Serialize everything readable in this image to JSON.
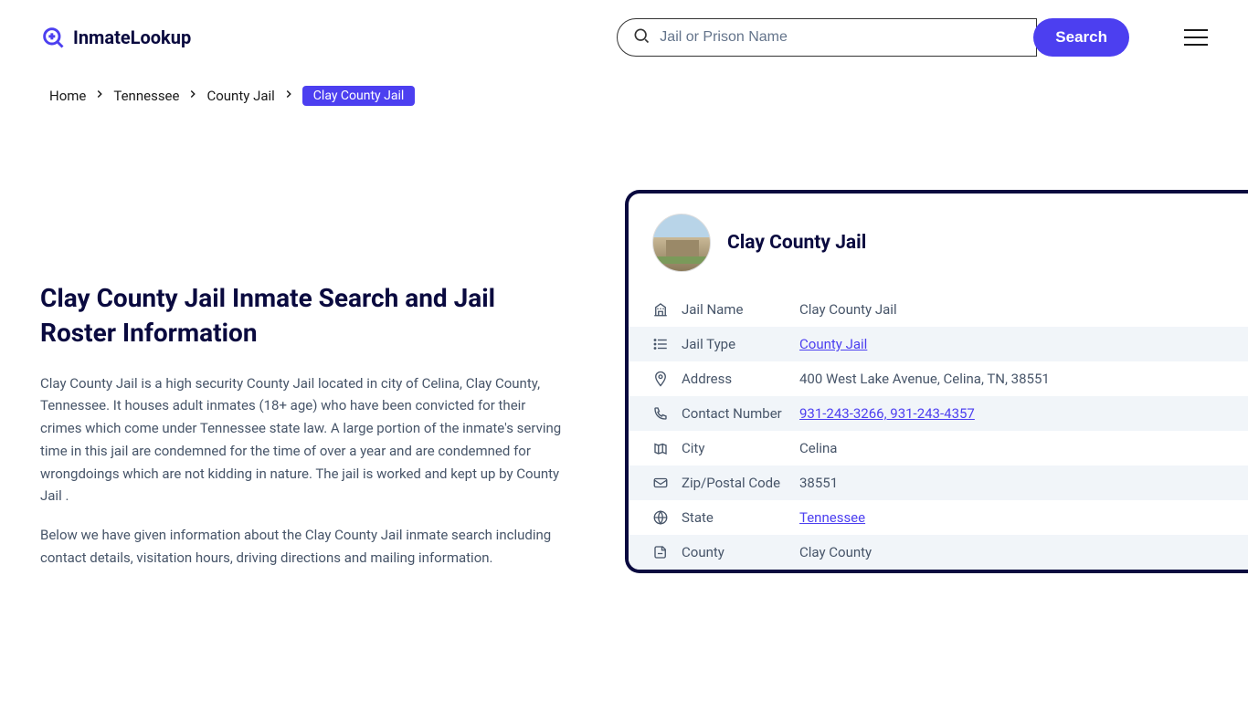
{
  "header": {
    "logo_text": "InmateLookup",
    "search_placeholder": "Jail or Prison Name",
    "search_button": "Search"
  },
  "breadcrumb": {
    "items": [
      "Home",
      "Tennessee",
      "County Jail"
    ],
    "current": "Clay County Jail"
  },
  "page": {
    "title": "Clay County Jail Inmate Search and Jail Roster Information",
    "paragraph1": "Clay County Jail is a high security County Jail located in city of Celina, Clay County, Tennessee. It houses adult inmates (18+ age) who have been convicted for their crimes which come under Tennessee state law. A large portion of the inmate's serving time in this jail are condemned for the time of over a year and are condemned for wrongdoings which are not kidding in nature. The jail is worked and kept up by County Jail .",
    "paragraph2": "Below we have given information about the Clay County Jail inmate search including contact details, visitation hours, driving directions and mailing information."
  },
  "card": {
    "title": "Clay County Jail",
    "rows": [
      {
        "label": "Jail Name",
        "value": "Clay County Jail",
        "link": false
      },
      {
        "label": "Jail Type",
        "value": "County Jail",
        "link": true
      },
      {
        "label": "Address",
        "value": "400 West Lake Avenue, Celina, TN, 38551",
        "link": false
      },
      {
        "label": "Contact Number",
        "value": "931-243-3266, 931-243-4357",
        "link": true
      },
      {
        "label": "City",
        "value": "Celina",
        "link": false
      },
      {
        "label": "Zip/Postal Code",
        "value": "38551",
        "link": false
      },
      {
        "label": "State",
        "value": "Tennessee",
        "link": true
      },
      {
        "label": "County",
        "value": "Clay County",
        "link": false
      }
    ]
  }
}
